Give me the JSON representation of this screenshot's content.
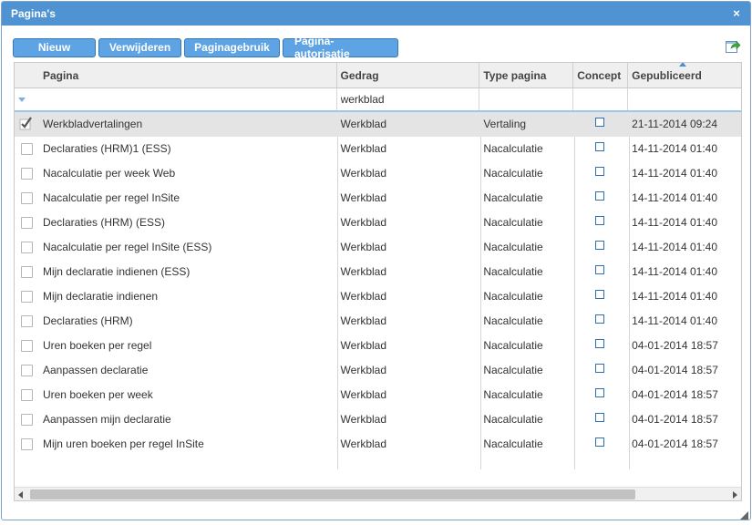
{
  "window": {
    "title": "Pagina's",
    "close_symbol": "×"
  },
  "toolbar": {
    "new_label": "Nieuw",
    "delete_label": "Verwijderen",
    "usage_label": "Paginagebruik",
    "authorization_label": "Pagina-autorisatie",
    "export_icon": "export-icon"
  },
  "grid": {
    "columns": [
      "Pagina",
      "Gedrag",
      "Type pagina",
      "Concept",
      "Gepubliceerd"
    ],
    "sorted_column": "Gepubliceerd",
    "filter": {
      "pagina": "",
      "gedrag": "werkblad",
      "type": "",
      "concept": "",
      "gepubliceerd": ""
    },
    "rows": [
      {
        "pagina": "Werkbladvertalingen",
        "gedrag": "Werkblad",
        "type": "Vertaling",
        "concept": false,
        "gepubliceerd": "21-11-2014 09:24",
        "selected": true
      },
      {
        "pagina": "Declaraties (HRM)1 (ESS)",
        "gedrag": "Werkblad",
        "type": "Nacalculatie",
        "concept": false,
        "gepubliceerd": "14-11-2014 01:40",
        "selected": false
      },
      {
        "pagina": "Nacalculatie per week Web",
        "gedrag": "Werkblad",
        "type": "Nacalculatie",
        "concept": false,
        "gepubliceerd": "14-11-2014 01:40",
        "selected": false
      },
      {
        "pagina": "Nacalculatie per regel InSite",
        "gedrag": "Werkblad",
        "type": "Nacalculatie",
        "concept": false,
        "gepubliceerd": "14-11-2014 01:40",
        "selected": false
      },
      {
        "pagina": "Declaraties (HRM) (ESS)",
        "gedrag": "Werkblad",
        "type": "Nacalculatie",
        "concept": false,
        "gepubliceerd": "14-11-2014 01:40",
        "selected": false
      },
      {
        "pagina": "Nacalculatie per regel InSite (ESS)",
        "gedrag": "Werkblad",
        "type": "Nacalculatie",
        "concept": false,
        "gepubliceerd": "14-11-2014 01:40",
        "selected": false
      },
      {
        "pagina": "Mijn declaratie indienen (ESS)",
        "gedrag": "Werkblad",
        "type": "Nacalculatie",
        "concept": false,
        "gepubliceerd": "14-11-2014 01:40",
        "selected": false
      },
      {
        "pagina": "Mijn declaratie indienen",
        "gedrag": "Werkblad",
        "type": "Nacalculatie",
        "concept": false,
        "gepubliceerd": "14-11-2014 01:40",
        "selected": false
      },
      {
        "pagina": "Declaraties (HRM)",
        "gedrag": "Werkblad",
        "type": "Nacalculatie",
        "concept": false,
        "gepubliceerd": "14-11-2014 01:40",
        "selected": false
      },
      {
        "pagina": "Uren boeken per regel",
        "gedrag": "Werkblad",
        "type": "Nacalculatie",
        "concept": false,
        "gepubliceerd": "04-01-2014 18:57",
        "selected": false
      },
      {
        "pagina": "Aanpassen declaratie",
        "gedrag": "Werkblad",
        "type": "Nacalculatie",
        "concept": false,
        "gepubliceerd": "04-01-2014 18:57",
        "selected": false
      },
      {
        "pagina": "Uren boeken per week",
        "gedrag": "Werkblad",
        "type": "Nacalculatie",
        "concept": false,
        "gepubliceerd": "04-01-2014 18:57",
        "selected": false
      },
      {
        "pagina": "Aanpassen mijn declaratie",
        "gedrag": "Werkblad",
        "type": "Nacalculatie",
        "concept": false,
        "gepubliceerd": "04-01-2014 18:57",
        "selected": false
      },
      {
        "pagina": "Mijn uren boeken per regel InSite",
        "gedrag": "Werkblad",
        "type": "Nacalculatie",
        "concept": false,
        "gepubliceerd": "04-01-2014 18:57",
        "selected": false
      }
    ]
  },
  "colors": {
    "titlebar": "#4f93d2",
    "button": "#5ea3e4",
    "selected_row": "#e4e4e4",
    "concept_checkbox": "#2f6fb5"
  }
}
